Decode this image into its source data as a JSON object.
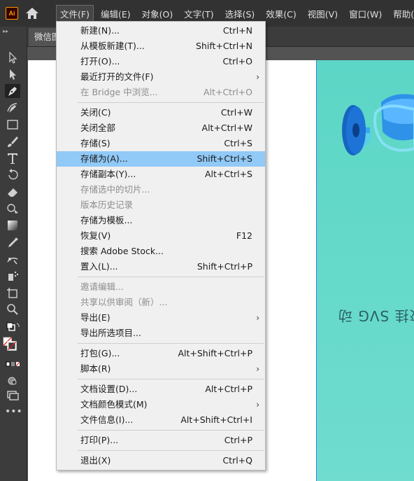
{
  "app": {
    "logo": "Ai"
  },
  "menubar": [
    {
      "label": "文件(F)",
      "active": true
    },
    {
      "label": "编辑(E)"
    },
    {
      "label": "对象(O)"
    },
    {
      "label": "文字(T)"
    },
    {
      "label": "选择(S)"
    },
    {
      "label": "效果(C)"
    },
    {
      "label": "视图(V)"
    },
    {
      "label": "窗口(W)"
    },
    {
      "label": "帮助(H)"
    }
  ],
  "doc_tab": {
    "title": "微信图"
  },
  "artwork": {
    "mirrored_text": "校挂 SVG 动"
  },
  "file_menu": {
    "groups": [
      [
        {
          "label": "新建(N)...",
          "shortcut": "Ctrl+N"
        },
        {
          "label": "从模板新建(T)...",
          "shortcut": "Shift+Ctrl+N"
        },
        {
          "label": "打开(O)...",
          "shortcut": "Ctrl+O"
        },
        {
          "label": "最近打开的文件(F)",
          "submenu": true
        },
        {
          "label": "在 Bridge 中浏览...",
          "shortcut": "Alt+Ctrl+O",
          "disabled": true
        }
      ],
      [
        {
          "label": "关闭(C)",
          "shortcut": "Ctrl+W"
        },
        {
          "label": "关闭全部",
          "shortcut": "Alt+Ctrl+W"
        },
        {
          "label": "存储(S)",
          "shortcut": "Ctrl+S"
        },
        {
          "label": "存储为(A)...",
          "shortcut": "Shift+Ctrl+S",
          "highlighted": true
        },
        {
          "label": "存储副本(Y)...",
          "shortcut": "Alt+Ctrl+S"
        },
        {
          "label": "存储选中的切片...",
          "disabled": true
        },
        {
          "label": "版本历史记录",
          "disabled": true
        },
        {
          "label": "存储为模板..."
        },
        {
          "label": "恢复(V)",
          "shortcut": "F12"
        },
        {
          "label": "搜索 Adobe Stock..."
        },
        {
          "label": "置入(L)...",
          "shortcut": "Shift+Ctrl+P"
        }
      ],
      [
        {
          "label": "邀请编辑...",
          "disabled": true
        },
        {
          "label": "共享以供审阅（新）...",
          "disabled": true
        },
        {
          "label": "导出(E)",
          "submenu": true
        },
        {
          "label": "导出所选项目..."
        }
      ],
      [
        {
          "label": "打包(G)...",
          "shortcut": "Alt+Shift+Ctrl+P"
        },
        {
          "label": "脚本(R)",
          "submenu": true
        }
      ],
      [
        {
          "label": "文档设置(D)...",
          "shortcut": "Alt+Ctrl+P"
        },
        {
          "label": "文档颜色模式(M)",
          "submenu": true
        },
        {
          "label": "文件信息(I)...",
          "shortcut": "Alt+Shift+Ctrl+I"
        }
      ],
      [
        {
          "label": "打印(P)...",
          "shortcut": "Ctrl+P"
        }
      ],
      [
        {
          "label": "退出(X)",
          "shortcut": "Ctrl+Q"
        }
      ]
    ]
  },
  "tools": [
    {
      "name": "selection-tool-icon"
    },
    {
      "name": "direct-selection-tool-icon"
    },
    {
      "name": "pen-tool-icon",
      "selected": true
    },
    {
      "name": "curvature-tool-icon"
    },
    {
      "name": "rectangle-tool-icon"
    },
    {
      "name": "paintbrush-tool-icon"
    },
    {
      "name": "type-tool-icon"
    },
    {
      "name": "rotate-tool-icon"
    },
    {
      "name": "eraser-tool-icon"
    },
    {
      "name": "shape-builder-tool-icon"
    },
    {
      "name": "gradient-tool-icon"
    },
    {
      "name": "eyedropper-tool-icon"
    },
    {
      "name": "puppet-warp-tool-icon"
    },
    {
      "name": "symbol-sprayer-tool-icon"
    },
    {
      "name": "artboard-tool-icon"
    },
    {
      "name": "zoom-tool-icon"
    }
  ],
  "colors": {
    "menubar": "#323232",
    "toolbar": "#3c3c3c",
    "highlight": "#91c9f7",
    "artwork": "#5cd6c6",
    "accent": "#ff9a00"
  }
}
